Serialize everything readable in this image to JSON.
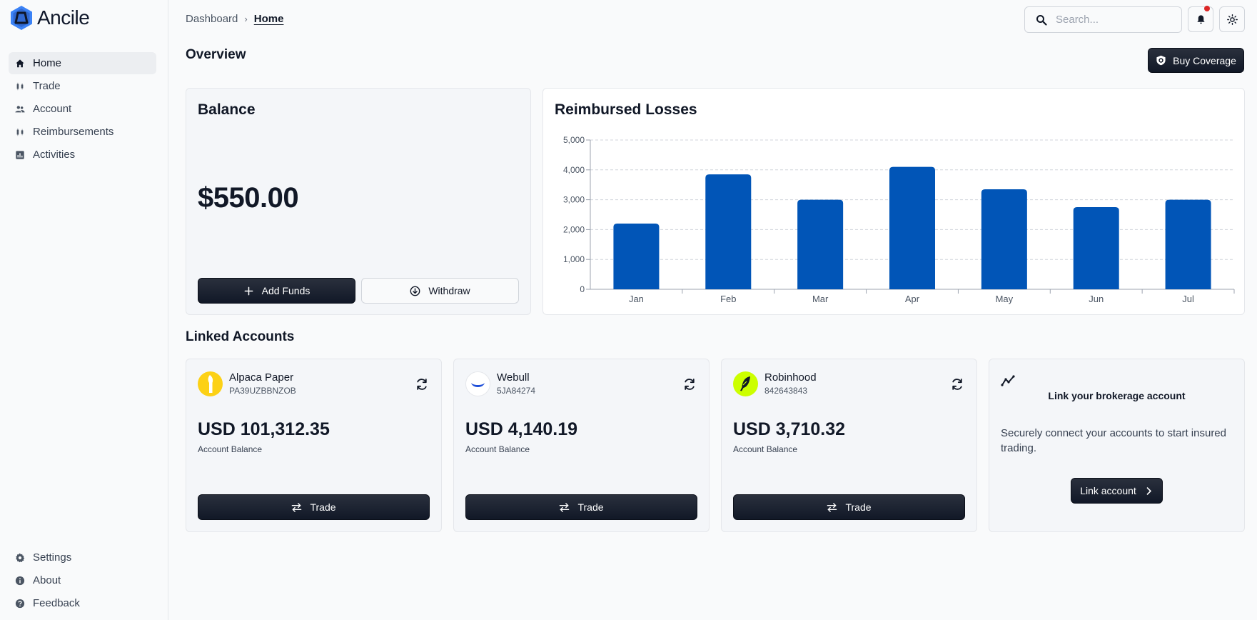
{
  "app": {
    "name": "Ancile"
  },
  "sidebar": {
    "items": [
      {
        "label": "Home",
        "icon": "home-icon",
        "active": true
      },
      {
        "label": "Trade",
        "icon": "candlestick-icon"
      },
      {
        "label": "Account",
        "icon": "users-icon"
      },
      {
        "label": "Reimbursements",
        "icon": "candlestick-icon"
      },
      {
        "label": "Activities",
        "icon": "bar-chart-icon"
      }
    ],
    "bottom": [
      {
        "label": "Settings",
        "icon": "gear-icon"
      },
      {
        "label": "About",
        "icon": "info-icon"
      },
      {
        "label": "Feedback",
        "icon": "help-icon"
      }
    ]
  },
  "header": {
    "breadcrumb": [
      "Dashboard",
      "Home"
    ],
    "search_placeholder": "Search...",
    "has_notification": true
  },
  "overview": {
    "title": "Overview",
    "buy_coverage_label": "Buy Coverage"
  },
  "balance": {
    "title": "Balance",
    "amount": "$550.00",
    "add_funds_label": "Add Funds",
    "withdraw_label": "Withdraw"
  },
  "chart_data": {
    "type": "bar",
    "title": "Reimbursed Losses",
    "categories": [
      "Jan",
      "Feb",
      "Mar",
      "Apr",
      "May",
      "Jun",
      "Jul"
    ],
    "values": [
      2200,
      3850,
      3000,
      4100,
      3350,
      2750,
      3000
    ],
    "ylim": [
      0,
      5000
    ],
    "yticks": [
      "0",
      "1,000",
      "2,000",
      "3,000",
      "4,000",
      "5,000"
    ],
    "bar_color": "#0155b7",
    "grid": true
  },
  "linked": {
    "title": "Linked Accounts",
    "accounts": [
      {
        "name": "Alpaca Paper",
        "id": "PA39UZBBNZOB",
        "balance": "USD 101,312.35",
        "sub": "Account Balance",
        "trade_label": "Trade",
        "logo": "alpaca-logo"
      },
      {
        "name": "Webull",
        "id": "5JA84274",
        "balance": "USD 4,140.19",
        "sub": "Account Balance",
        "trade_label": "Trade",
        "logo": "webull-logo"
      },
      {
        "name": "Robinhood",
        "id": "842643843",
        "balance": "USD 3,710.32",
        "sub": "Account Balance",
        "trade_label": "Trade",
        "logo": "robinhood-logo"
      }
    ],
    "link_card": {
      "title": "Link your brokerage account",
      "description": "Securely connect your accounts to start insured trading.",
      "button_label": "Link account"
    }
  },
  "colors": {
    "accent": "#0155b7",
    "dark_button": "#111827",
    "notification": "#dc2626"
  }
}
